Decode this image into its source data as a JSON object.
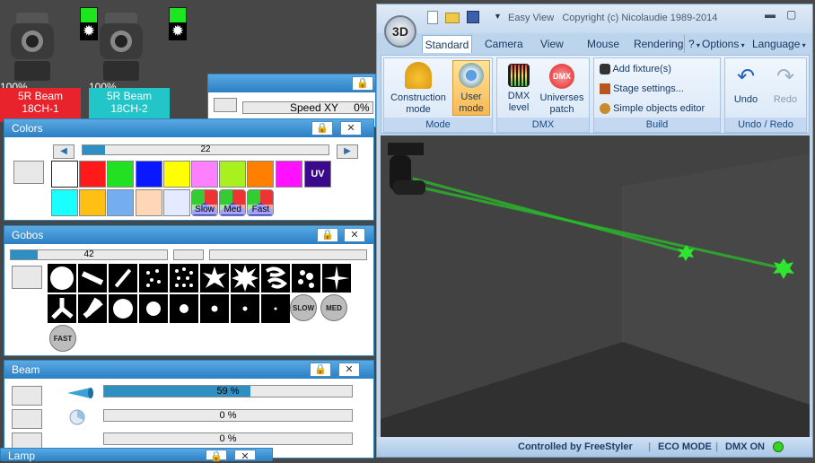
{
  "fixtures": [
    {
      "name": "5R Beam",
      "channel": "18CH-1",
      "pct": "100%",
      "color": "#e8232b"
    },
    {
      "name": "5R Beam",
      "channel": "18CH-2",
      "pct": "100%",
      "color": "#22c6c8"
    }
  ],
  "speed_panel": {
    "label": "Speed XY",
    "value": "0%"
  },
  "colors_panel": {
    "title": "Colors",
    "slider_value": "22",
    "slider_fill": 0.09,
    "swatches_row1": [
      "#ffffff",
      "#ff1a1a",
      "#22e022",
      "#0a18ff",
      "#ffff00",
      "#ff80ff",
      "#a8f01e",
      "#ff8000",
      "#ff10ff"
    ],
    "uv_label": "UV",
    "uv_color": "#3b0a8c",
    "swatches_row2": [
      "#19ffff",
      "#ffc013",
      "#74aef0",
      "#ffd7b7",
      "#e4eaff"
    ],
    "speed_labels": [
      "Slow",
      "Med",
      "Fast"
    ]
  },
  "gobos_panel": {
    "title": "Gobos",
    "slider_value": "42",
    "slider_fill": 0.17,
    "speed_labels": [
      "SLOW",
      "MED",
      "FAST"
    ]
  },
  "beam_panel": {
    "title": "Beam",
    "rows": [
      {
        "value": "59 %",
        "fill": 0.59,
        "icon": "beam-zoom-icon"
      },
      {
        "value": "0 %",
        "fill": 0,
        "icon": "focus-icon"
      },
      {
        "value": "0 %",
        "fill": 0,
        "icon": ""
      }
    ]
  },
  "lamp_panel": {
    "title": "Lamp"
  },
  "easy_view": {
    "title": "Easy View   Copyright (c) Nicolaudie 1989-2014",
    "logo": "3D",
    "tabs": [
      "Standard",
      "Camera",
      "View",
      "Mouse",
      "Rendering"
    ],
    "help": "?",
    "menu_options": "Options",
    "menu_language": "Language",
    "groups": {
      "mode": "Mode",
      "dmx": "DMX",
      "build": "Build",
      "undo": "Undo / Redo"
    },
    "buttons": {
      "construction": "Construction mode",
      "user": "User mode",
      "dmx_level": "DMX level",
      "universes": "Universes patch",
      "add_fixture": "Add fixture(s)",
      "stage": "Stage settings...",
      "simple": "Simple objects editor",
      "undo": "Undo",
      "redo": "Redo"
    },
    "status": {
      "controlled": "Controlled by FreeStyler",
      "eco": "ECO MODE",
      "dmx": "DMX ON"
    }
  },
  "colors": {
    "panel_title": "#2a7fc3",
    "accent": "#2e8fc3",
    "status_led": "#39d324"
  }
}
